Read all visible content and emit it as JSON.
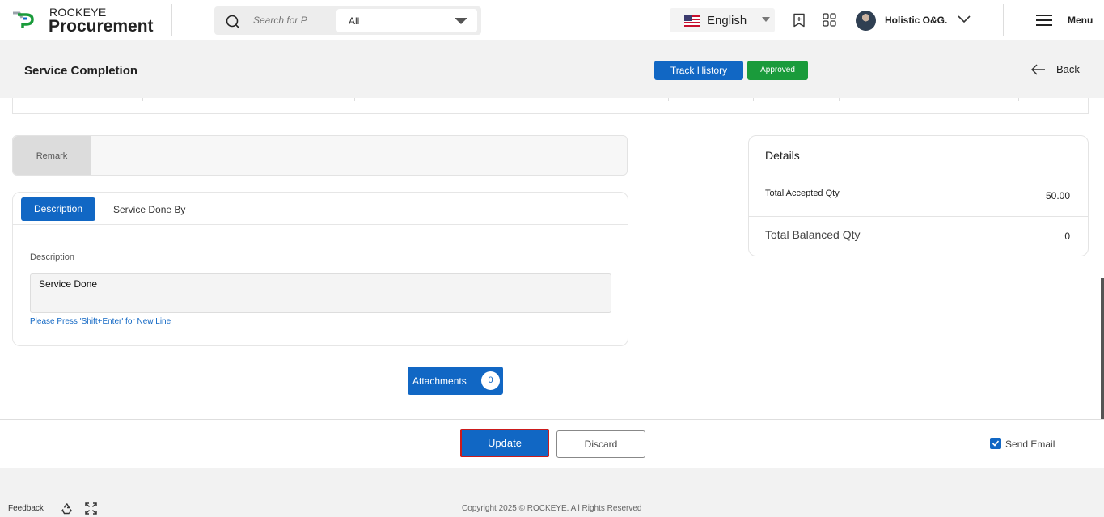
{
  "header": {
    "brand_small": "ROCKEYE",
    "brand_big": "Procurement",
    "search": {
      "placeholder": "Search for P",
      "value": ""
    },
    "search_scope": "All",
    "language": "English",
    "user_name": "Holistic O&G.",
    "menu_label": "Menu"
  },
  "page": {
    "title": "Service Completion",
    "track_history_label": "Track History",
    "status_badge": "Approved",
    "back_label": "Back"
  },
  "remark": {
    "label": "Remark",
    "value": ""
  },
  "tabs": [
    {
      "label": "Description",
      "active": true
    },
    {
      "label": "Service Done By",
      "active": false
    }
  ],
  "description": {
    "label": "Description",
    "value": "Service Done",
    "hint": "Please Press 'Shift+Enter' for New Line"
  },
  "attachments": {
    "label": "Attachments",
    "count": "0"
  },
  "details": {
    "title": "Details",
    "rows": [
      {
        "label": "Total Accepted Qty",
        "value": "50.00"
      },
      {
        "label": "Total Balanced Qty",
        "value": "0"
      }
    ]
  },
  "actions": {
    "update_label": "Update",
    "discard_label": "Discard",
    "send_email_label": "Send Email",
    "send_email_checked": true
  },
  "footer": {
    "feedback_label": "Feedback",
    "copyright": "Copyright 2025 © ROCKEYE. All Rights Reserved"
  },
  "colors": {
    "primary": "#1167c4",
    "approved": "#1a9b3b",
    "highlight_border": "#cc1b1b"
  },
  "icons": [
    "logo-icon",
    "search-icon",
    "chevron-down-icon",
    "us-flag-icon",
    "bookmark-icon",
    "apps-grid-icon",
    "avatar",
    "hamburger-menu-icon",
    "back-arrow-icon",
    "checkbox-check-icon",
    "recycle-icon",
    "fullscreen-icon"
  ]
}
